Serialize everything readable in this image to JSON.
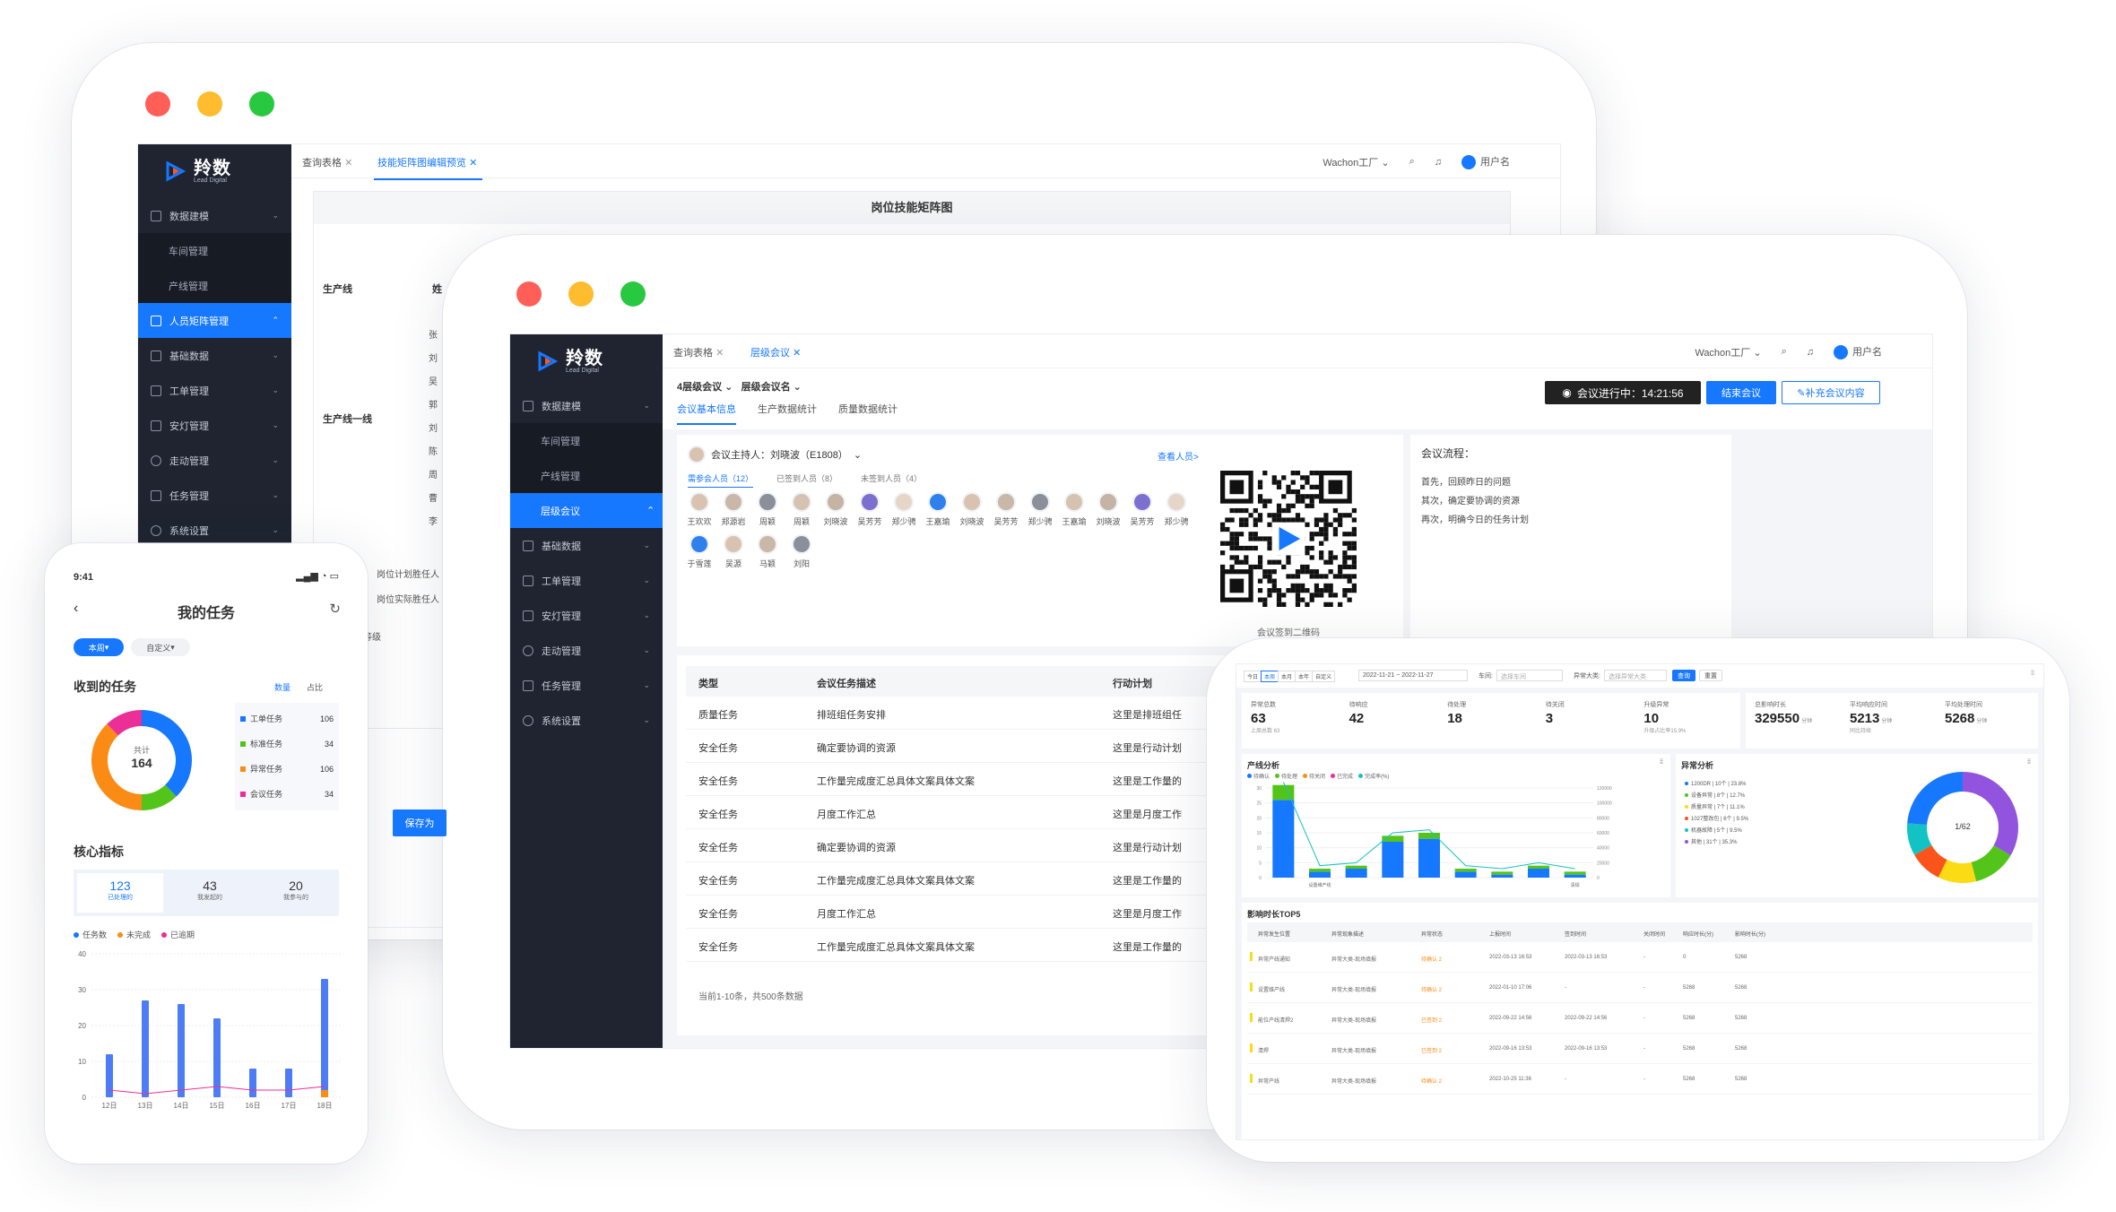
{
  "brand": {
    "name": "羚数",
    "sub": "Lead Digital"
  },
  "colors": {
    "accent": "#1677ff",
    "sidebar": "#1f2430",
    "red": "#ff5f57",
    "yellow": "#febc2e",
    "green": "#28c840"
  },
  "back": {
    "tabs": [
      {
        "label": "查询表格"
      },
      {
        "label": "技能矩阵图编辑预览"
      }
    ],
    "topbar": {
      "factory": "Wachon工厂",
      "user": "用户名"
    },
    "menu": [
      {
        "label": "数据建模"
      },
      {
        "label": "车间管理"
      },
      {
        "label": "产线管理"
      },
      {
        "label": "人员矩阵管理"
      },
      {
        "label": "基础数据"
      },
      {
        "label": "工单管理"
      },
      {
        "label": "安灯管理"
      },
      {
        "label": "走动管理"
      },
      {
        "label": "任务管理"
      },
      {
        "label": "系统设置"
      }
    ],
    "title": "岗位技能矩阵图",
    "col_line": "生产线",
    "col_name": "姓",
    "group": "生产线一线",
    "names": [
      "张",
      "刘",
      "吴",
      "郭",
      "刘",
      "陈",
      "周",
      "曹",
      "李"
    ],
    "foot1": "岗位计划胜任人",
    "foot2": "岗位实际胜任人",
    "level": "等级",
    "save": "保存为"
  },
  "middle": {
    "tabs": [
      {
        "label": "查询表格"
      },
      {
        "label": "层级会议"
      }
    ],
    "topbar": {
      "factory": "Wachon工厂",
      "user": "用户名"
    },
    "menu": [
      {
        "label": "数据建模"
      },
      {
        "label": "车间管理"
      },
      {
        "label": "产线管理"
      },
      {
        "label": "层级会议"
      },
      {
        "label": "基础数据"
      },
      {
        "label": "工单管理"
      },
      {
        "label": "安灯管理"
      },
      {
        "label": "走动管理"
      },
      {
        "label": "任务管理"
      },
      {
        "label": "系统设置"
      }
    ],
    "crumb1": "4层级会议",
    "crumb2": "层级会议名",
    "subtabs": [
      {
        "label": "会议基本信息"
      },
      {
        "label": "生产数据统计"
      },
      {
        "label": "质量数据统计"
      }
    ],
    "status": "会议进行中：14:21:56",
    "end_btn": "结束会议",
    "add_btn": "补充会议内容",
    "host": "会议主持人：刘晓波（E1808）",
    "view_people": "查看人员>",
    "ptabs": [
      {
        "label": "需参会人员（12）"
      },
      {
        "label": "已签到人员（8）"
      },
      {
        "label": "未签到人员（4）"
      }
    ],
    "people": [
      "王欢欢",
      "郑源岩",
      "周颖",
      "周颖",
      "刘晓波",
      "吴芳芳",
      "郑少骋",
      "王嘉瑜",
      "刘晓波",
      "吴芳芳",
      "郑少骋",
      "王嘉瑜",
      "刘晓波",
      "吴芳芳",
      "郑少骋",
      "于雪莲",
      "吴源",
      "马颖",
      "刘阳"
    ],
    "qr_label": "会议签到二维码",
    "flow_title": "会议流程：",
    "flow": [
      "首先，回顾昨日的问题",
      "其次，确定要协调的资源",
      "再次，明确今日的任务计划"
    ],
    "table_headers": [
      "类型",
      "会议任务描述",
      "行动计划"
    ],
    "rows": [
      [
        "质量任务",
        "排班组任务安排",
        "这里是排班组任"
      ],
      [
        "安全任务",
        "确定要协调的资源",
        "这里是行动计划"
      ],
      [
        "安全任务",
        "工作量完成度汇总具体文案具体文案",
        "这里是工作量的"
      ],
      [
        "安全任务",
        "月度工作汇总",
        "这里是月度工作"
      ],
      [
        "安全任务",
        "确定要协调的资源",
        "这里是行动计划"
      ],
      [
        "安全任务",
        "工作量完成度汇总具体文案具体文案",
        "这里是工作量的"
      ],
      [
        "安全任务",
        "月度工作汇总",
        "这里是月度工作"
      ],
      [
        "安全任务",
        "工作量完成度汇总具体文案具体文案",
        "这里是工作量的"
      ]
    ],
    "pager": "当前1-10条，共500条数据"
  },
  "phone": {
    "time": "9:41",
    "title": "我的任务",
    "filter1": "本周",
    "filter2": "自定义",
    "received": "收到的任务",
    "count_tab": "数量",
    "ratio_tab": "占比",
    "donut_label": "共计",
    "donut_total": "164",
    "legend": [
      {
        "label": "工单任务",
        "value": "106",
        "color": "#1677ff"
      },
      {
        "label": "标准任务",
        "value": "34",
        "color": "#52c41a"
      },
      {
        "label": "异常任务",
        "value": "106",
        "color": "#fa8c16"
      },
      {
        "label": "会议任务",
        "value": "34",
        "color": "#eb2f96"
      }
    ],
    "donut_values": [
      106,
      34,
      106,
      34
    ],
    "core": "核心指标",
    "metrics": [
      {
        "value": "123",
        "label": "已处理的"
      },
      {
        "value": "43",
        "label": "我发起的"
      },
      {
        "value": "20",
        "label": "我参与的"
      }
    ],
    "chart_legend": [
      {
        "label": "任务数",
        "color": "#1677ff"
      },
      {
        "label": "未完成",
        "color": "#fa8c16"
      },
      {
        "label": "已逾期",
        "color": "#eb2f96"
      }
    ]
  },
  "chart_data": [
    {
      "type": "bar",
      "title": "",
      "categories": [
        "12日",
        "13日",
        "14日",
        "15日",
        "16日",
        "17日",
        "18日"
      ],
      "series": [
        {
          "name": "任务数",
          "values": [
            12,
            27,
            26,
            22,
            8,
            8,
            33
          ]
        },
        {
          "name": "未完成",
          "values": [
            0,
            0,
            0,
            0,
            0,
            0,
            2
          ]
        },
        {
          "name": "已逾期",
          "values": [
            2,
            1,
            2,
            3,
            2,
            2,
            3
          ]
        }
      ],
      "yticks": [
        0,
        10,
        20,
        30,
        40
      ],
      "ylim": [
        0,
        40
      ]
    },
    {
      "type": "bar",
      "title": "产线分析",
      "legend": [
        "待确认",
        "待处理",
        "待关闭",
        "已完成",
        "完成率(%)"
      ],
      "categories": [
        "",
        "设置维产线",
        "",
        "",
        "",
        "",
        "",
        "",
        "清焊"
      ],
      "series": [
        {
          "name": "待确认",
          "values": [
            26,
            2,
            3,
            12,
            13,
            2,
            1,
            3,
            1
          ]
        },
        {
          "name": "待处理",
          "values": [
            5,
            1,
            1,
            2,
            2,
            1,
            1,
            1,
            1
          ]
        }
      ],
      "yticks_left": [
        0,
        5,
        10,
        15,
        20,
        25,
        30
      ],
      "yticks_right": [
        0,
        20000,
        40000,
        60000,
        80000,
        100000,
        120000
      ]
    },
    {
      "type": "pie",
      "title": "异常分析",
      "center": "1/62"
    }
  ],
  "tablet": {
    "filters": [
      "今日",
      "本周",
      "本月",
      "本年",
      "自定义"
    ],
    "date_range": "2022-11-21 ~ 2022-11-27",
    "line_label": "车间:",
    "line_placeholder": "选择车间",
    "type_label": "异常大类:",
    "type_placeholder": "选择异常大类",
    "query": "查询",
    "reset": "重置",
    "kpis": [
      {
        "label": "异常总数",
        "value": "63",
        "sub": "上周总数 63"
      },
      {
        "label": "待响应",
        "value": "42",
        "sub": ""
      },
      {
        "label": "待处理",
        "value": "18",
        "sub": ""
      },
      {
        "label": "待关闭",
        "value": "3",
        "sub": ""
      },
      {
        "label": "升级异常",
        "value": "10",
        "sub": "升级占比率15.9%"
      }
    ],
    "kpis2": [
      {
        "label": "总影响时长",
        "value": "329550",
        "unit": "分钟",
        "sub": ""
      },
      {
        "label": "平均响应时间",
        "value": "5213",
        "unit": "分钟",
        "sub": "同比持续"
      },
      {
        "label": "平均处理时间",
        "value": "5268",
        "unit": "分钟",
        "sub": ""
      }
    ],
    "pie_legend": [
      "1200DR | 10个 | 23.8%",
      "设备异常 | 8个 | 12.7%",
      "质量异常 | 7个 | 11.1%",
      "1027整改包 | 6个 | 9.5%",
      "机器故障 | 5个 | 9.5%",
      "其他 | 31个 | 35.3%"
    ],
    "top_title": "影响时长TOP5",
    "top_headers": [
      "异常发生位置",
      "异常现象描述",
      "异常状态",
      "上报时间",
      "签到时间",
      "关闭时间",
      "响应时长(分)",
      "影响时长(分)"
    ],
    "top_rows": [
      [
        "异常产线通知",
        "异常大类-现场填报",
        "待确认 2",
        "2022-03-13 16:53",
        "2022-03-13 16:53",
        "-",
        "0",
        "5268"
      ],
      [
        "设置维产线",
        "异常大类-现场填报",
        "待确认 2",
        "2022-01-10 17:06",
        "-",
        "-",
        "5268",
        "5268"
      ],
      [
        "能位产线清焊2",
        "异常大类-现场填报",
        "已签到 2",
        "2022-09-22 14:56",
        "2022-09-22 14:56",
        "-",
        "5268",
        "5268"
      ],
      [
        "清焊",
        "异常大类-现场填报",
        "已签到 2",
        "2022-09-16 13:53",
        "2022-09-16 13:53",
        "-",
        "5268",
        "5268"
      ],
      [
        "异常产线",
        "异常大类-现场填报",
        "待确认 2",
        "2022-10-25 11:36",
        "-",
        "-",
        "5268",
        "5268"
      ]
    ]
  }
}
